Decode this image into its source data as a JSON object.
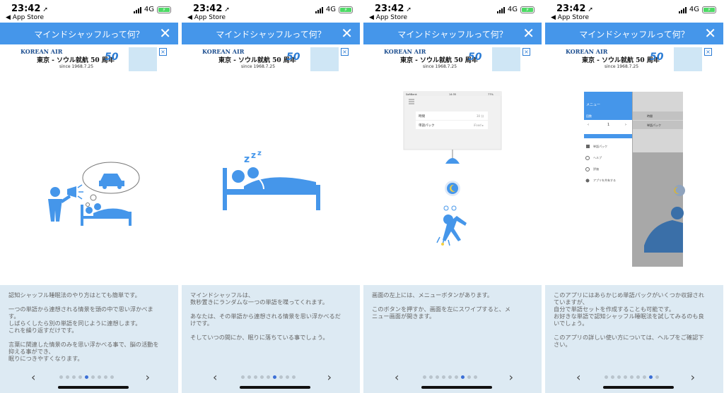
{
  "status_bar": {
    "time": "23:42",
    "back_label": "◀ App Store",
    "network": "4G"
  },
  "nav": {
    "title": "マインドシャッフルって何？",
    "close_label": "✕"
  },
  "ad": {
    "logo": "KOREAN AIR",
    "headline": "東京 - ソウル就航 50 周年",
    "since": "since 1968.7.25",
    "anniversary": "50",
    "ad_badge": "ⓘ✕"
  },
  "colors": {
    "primary": "#4596ea",
    "description_bg": "#ddeaf3",
    "dot_active": "#3c6fd6",
    "dot_inactive": "#b9c4cc"
  },
  "pages": [
    {
      "description": "認知シャッフル睡眠法のやり方はとても簡単です。\n\n一つの単語から連想される情景を頭の中で思い浮かべま\nす。\nしばらくしたら別の単語を同じように連想します。\nこれを繰り返すだけです。\n\n言葉に関連した情景のみを思い浮かべる事で、脳の活動を\n抑える事ができ、\n眠りにつきやすくなります。",
      "active_dot": 4
    },
    {
      "description": "マインドシャッフルは、\n数秒置きにランダムな一つの単語を喋ってくれます。\n\nあなたは、その単語から連想される情景を思い浮かべるだ\nけです。\n\nそしていつの間にか、眠りに落ちている事でしょう。",
      "active_dot": 5
    },
    {
      "description": "画面の左上には、メニューボタンがあります。\n\nこのボタンを押すか、画面を左にスワイプすると、メ\nニュー画面が開きます。",
      "active_dot": 6
    },
    {
      "description": "このアプリにはあらかじめ単語パックがいくつか収録され\nていますが、\n自分で単語セットを作成することも可能です。\nお好きな単語で認知シャッフル睡眠法を試してみるのも良\nいでしょう。\n\nこのアプリの詳しい使い方については、ヘルプをご確認下\nさい。",
      "active_dot": 7
    }
  ],
  "pager": {
    "prev_label": "‹",
    "next_label": "›",
    "dot_count": 9
  },
  "mock_phone": {
    "row1_label": "時間",
    "row1_value": "30 分",
    "row2_label": "単語パック",
    "row2_value": "iFood ▸",
    "menu_title": "メニュー",
    "menu_section": "回数",
    "counter_value": "1",
    "menu_items": [
      "単語パック",
      "ヘルプ",
      "評価",
      "アプリを共有する"
    ],
    "status_carrier": "SoftBank",
    "status_time": "14:35",
    "status_battery": "77%"
  }
}
